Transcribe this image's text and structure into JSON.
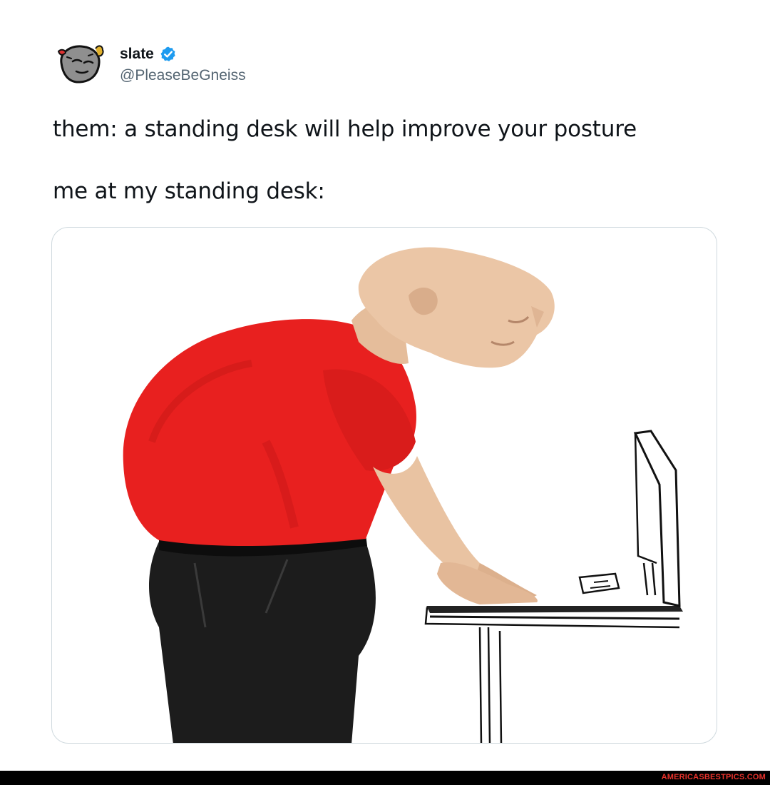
{
  "author": {
    "display_name": "slate",
    "handle": "@PleaseBeGneiss",
    "avatar_icon": "rock-face-avatar-icon",
    "verified_icon": "verified-badge-icon",
    "verified_color": "#1d9bf0"
  },
  "tweet": {
    "line1": "them: a standing desk will help improve your posture",
    "line2": "me at my standing desk:"
  },
  "media": {
    "subject": "hunched-man-at-standing-desk-illustration",
    "shirt_color": "#e8201f",
    "pants_color": "#1c1c1c",
    "skin_color": "#e9c3a2"
  },
  "footer": {
    "watermark": "AMERICASBESTPICS.COM",
    "watermark_color": "#e8322b"
  }
}
